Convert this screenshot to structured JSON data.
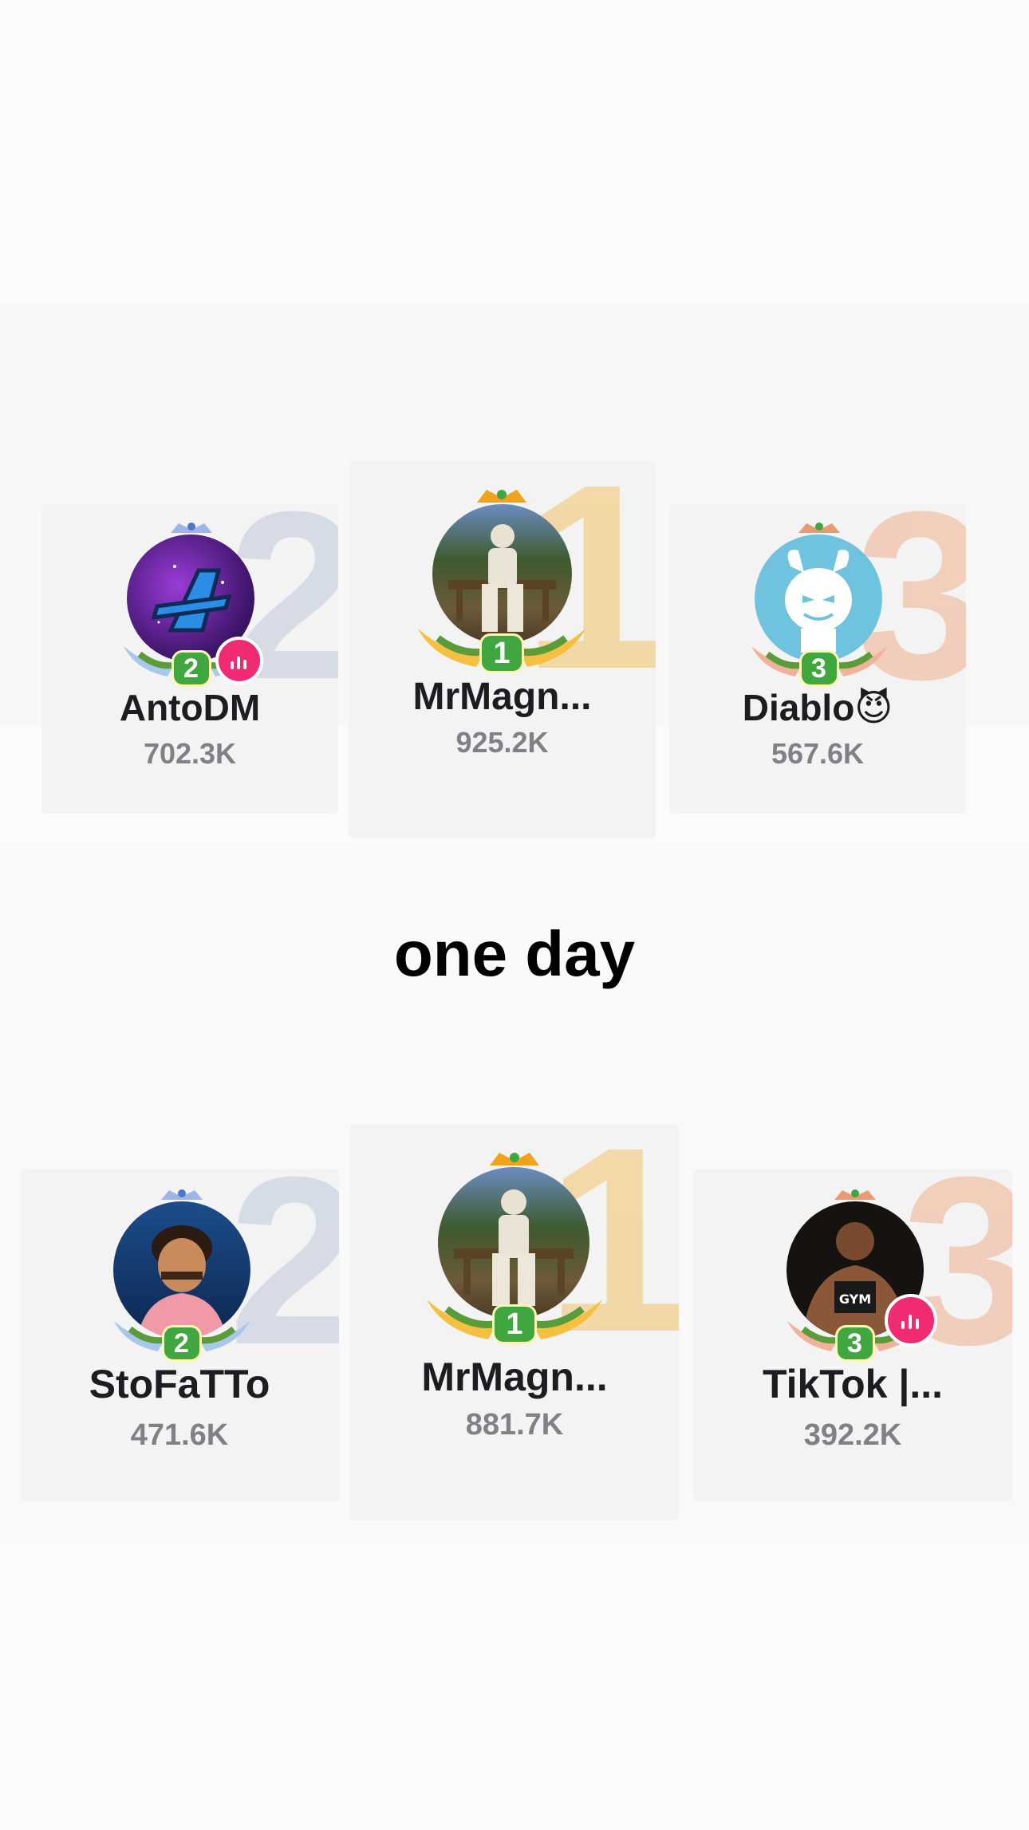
{
  "caption": "one day",
  "top_board": {
    "first": {
      "rank": "1",
      "name": "MrMagn...",
      "score": "925.2K"
    },
    "second": {
      "rank": "2",
      "name": "AntoDM",
      "score": "702.3K"
    },
    "third": {
      "rank": "3",
      "name": "Diablo😈",
      "score": "567.6K"
    }
  },
  "bottom_board": {
    "first": {
      "rank": "1",
      "name": "MrMagn...",
      "score": "881.7K"
    },
    "second": {
      "rank": "2",
      "name": "StoFaTTo",
      "score": "471.6K"
    },
    "third": {
      "rank": "3",
      "name": "TikTok |...",
      "score": "392.2K"
    }
  },
  "colors": {
    "live_badge": "#f02b74",
    "rank_badge": "#3fa640",
    "gold": "#f2d08e",
    "silver": "#cfd6e2",
    "bronze": "#f0c6ad"
  },
  "icons": {
    "live": "live-indicator-icon",
    "crown": "crown-icon",
    "laurel": "laurel-icon"
  }
}
